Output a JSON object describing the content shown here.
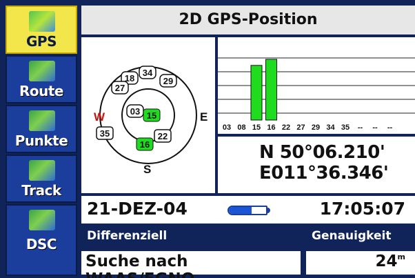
{
  "sidebar": {
    "items": [
      {
        "label": "GPS",
        "icon": "gps-icon",
        "active": true
      },
      {
        "label": "Route",
        "icon": "route-icon",
        "active": false
      },
      {
        "label": "Punkte",
        "icon": "waypoints-icon",
        "active": false
      },
      {
        "label": "Track",
        "icon": "track-icon",
        "active": false
      },
      {
        "label": "DSC",
        "icon": "dsc-icon",
        "active": false
      }
    ]
  },
  "header": {
    "title": "2D GPS-Position"
  },
  "skyview": {
    "directions": {
      "north": "N",
      "east": "E",
      "south": "S",
      "west": "W"
    },
    "satellites": [
      {
        "id": "34",
        "tracked": false
      },
      {
        "id": "29",
        "tracked": false
      },
      {
        "id": "18",
        "tracked": false
      },
      {
        "id": "27",
        "tracked": false
      },
      {
        "id": "03",
        "tracked": false
      },
      {
        "id": "15",
        "tracked": true
      },
      {
        "id": "35",
        "tracked": false
      },
      {
        "id": "22",
        "tracked": false
      },
      {
        "id": "16",
        "tracked": true
      }
    ]
  },
  "signal": {
    "labels": [
      "03",
      "08",
      "15",
      "16",
      "22",
      "27",
      "29",
      "34",
      "35",
      "--",
      "--",
      "--"
    ],
    "levels": [
      0,
      0,
      0.72,
      0.8,
      0,
      0,
      0,
      0,
      0,
      0,
      0,
      0
    ],
    "bar_color": "#1fdc1f"
  },
  "position": {
    "lat": "N  50°06.210'",
    "lon": "E011°36.346'"
  },
  "status": {
    "date": "21-DEZ-04",
    "time": "17:05:07",
    "battery_level": 0.62
  },
  "fields": {
    "differential_label": "Differenziell",
    "differential_value": "Suche nach WAAS/EGNO",
    "accuracy_label": "Genauigkeit",
    "accuracy_value": "24",
    "accuracy_unit": "m"
  },
  "colors": {
    "background": "#10245a",
    "tab_active": "#f2e64a",
    "tab_inactive": "#1b3d9c",
    "tracked_sat": "#1fdc1f"
  }
}
